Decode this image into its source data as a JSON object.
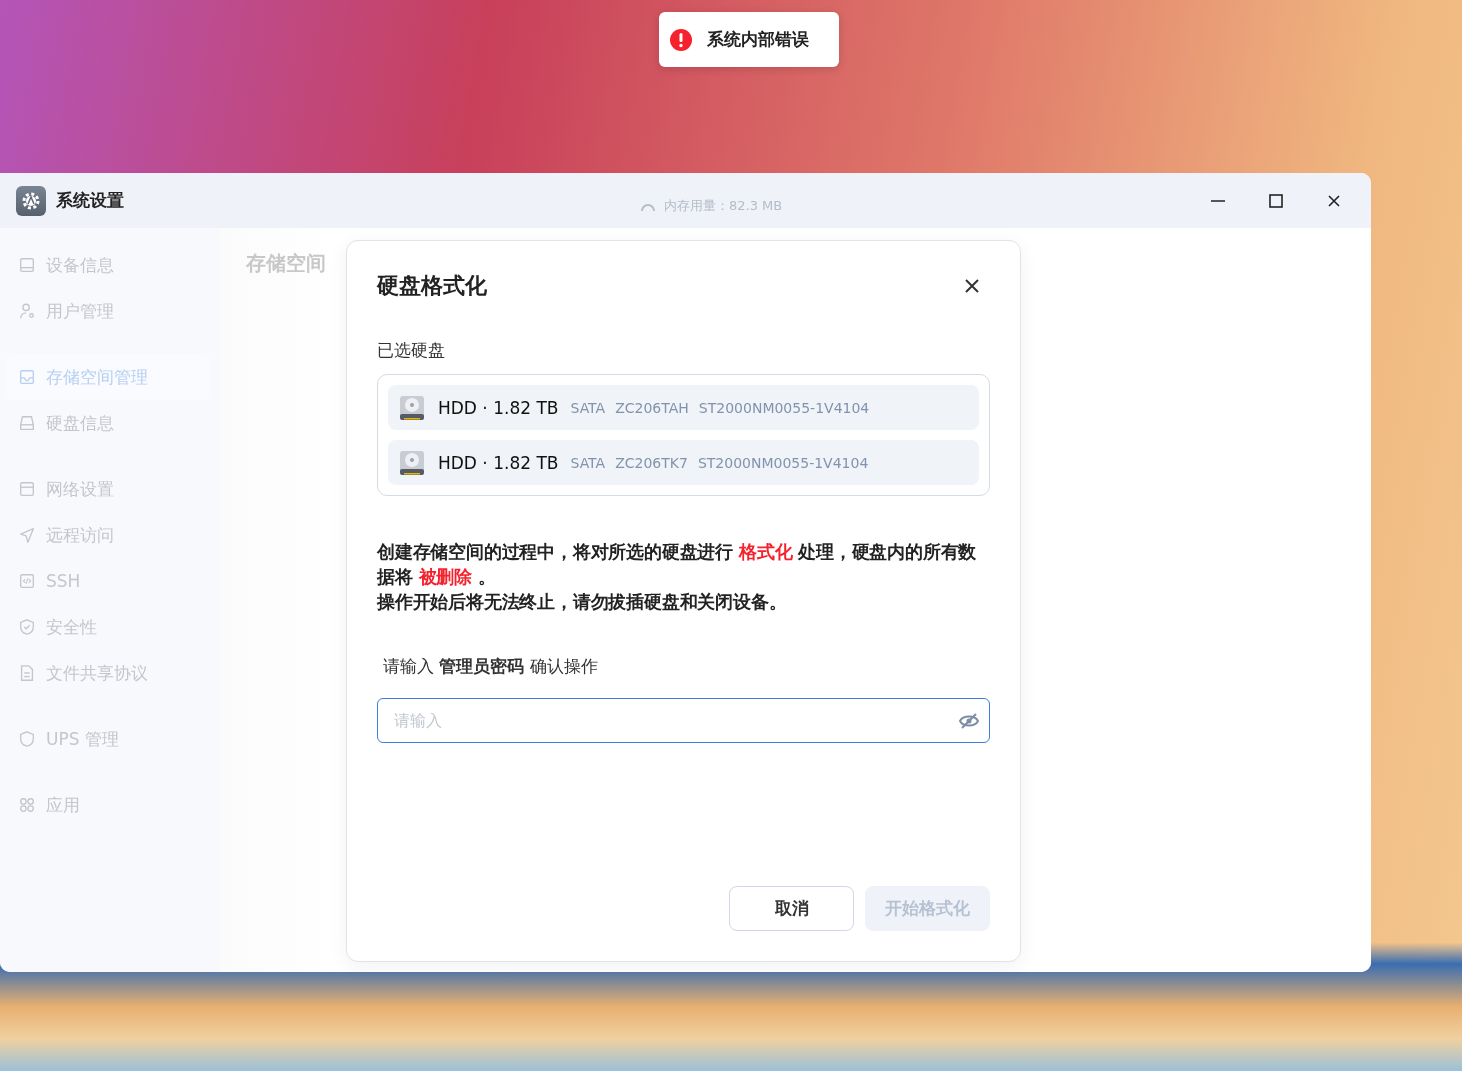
{
  "toast": {
    "kind": "error",
    "text": "系统内部错误"
  },
  "window": {
    "title": "系统设置",
    "memory": "内存用量：82.3 MB"
  },
  "sidebar": {
    "groups": [
      {
        "items": [
          {
            "label": "设备信息",
            "selected": false
          },
          {
            "label": "用户管理",
            "selected": false
          }
        ]
      },
      {
        "items": [
          {
            "label": "存储空间管理",
            "selected": true
          },
          {
            "label": "硬盘信息",
            "selected": false
          }
        ]
      },
      {
        "items": [
          {
            "label": "网络设置",
            "selected": false
          },
          {
            "label": "远程访问",
            "selected": false
          },
          {
            "label": "SSH",
            "selected": false
          },
          {
            "label": "安全性",
            "selected": false
          },
          {
            "label": "文件共享协议",
            "selected": false
          }
        ]
      },
      {
        "items": [
          {
            "label": "UPS 管理",
            "selected": false
          }
        ]
      },
      {
        "items": [
          {
            "label": "应用",
            "selected": false
          }
        ]
      }
    ]
  },
  "content": {
    "heading": "存储空间"
  },
  "dialog": {
    "title": "硬盘格式化",
    "section_label": "已选硬盘",
    "disks": [
      {
        "title": "HDD · 1.82 TB",
        "specs": [
          "SATA",
          "ZC206TAH",
          "ST2000NM0055-1V4104"
        ]
      },
      {
        "title": "HDD · 1.82 TB",
        "specs": [
          "SATA",
          "ZC206TK7",
          "ST2000NM0055-1V4104"
        ]
      }
    ],
    "warning": [
      "创建存储空间的过程中，将对所选的硬盘进行 **格式化** 处理，硬盘内的所有数据将 **被删除** 。",
      "操作开始后将无法终止，请勿拔插硬盘和关闭设备。"
    ],
    "prompt": "请输入 **管理员密码** 确认操作",
    "password": {
      "placeholder": "请输入"
    },
    "buttons": [
      {
        "label": "取消",
        "disabled": false,
        "primary": false
      },
      {
        "label": "开始格式化",
        "disabled": true,
        "primary": true
      }
    ]
  }
}
